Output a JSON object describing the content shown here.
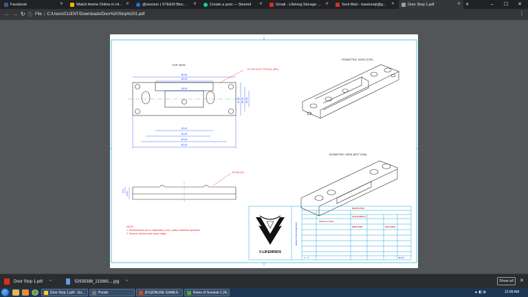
{
  "tabs": [
    {
      "title": "Facebook",
      "color": "#3b5998"
    },
    {
      "title": "Watch Anime Online in High Qu...",
      "color": "#f4b400"
    },
    {
      "title": "@sevison | STEEM Block Explorer",
      "color": "#1a73e8"
    },
    {
      "title": "Create a post — Steemit",
      "color": "#06d6a9"
    },
    {
      "title": "Gmail - Lifelong Storage at Email",
      "color": "#d93025"
    },
    {
      "title": "Sent Mail - maxtoneji@gmail.co...",
      "color": "#d93025"
    },
    {
      "title": "Door Stop 1.pdf",
      "color": "#9aa0a6"
    }
  ],
  "toolbar": {
    "back": "←",
    "forward": "→",
    "reload": "↻",
    "scheme": "File",
    "url": "C:/Users/CLIENT/Downloads/Door%20Stop%201.pdf",
    "menu": "⋮"
  },
  "window_controls": {
    "minimize": "–",
    "maximize": "☐",
    "close": "✕"
  },
  "drawing": {
    "top_view_title": "TOP VIEW",
    "iso_top_title": "ISOMETRIC VIEW (TOP)",
    "iso_bottom_title": "ISOMETRIC VIEW (BOTTOM)",
    "slot_note": "R 1.50 SLOT TYPICAL (4PL)",
    "side_callout": "R2.50 (2X)",
    "dims_top": [
      "80.00",
      "60.00",
      "18.00"
    ],
    "dims_bottom": [
      "30.00",
      "40.00",
      "60.00",
      "80.00"
    ],
    "dims_right": [
      "20.00",
      "25.00",
      "30.00"
    ],
    "side_dims": [
      "5.00",
      "12.00"
    ],
    "notes": [
      "NOTE:",
      "1. All dimensions are in millimeters ( mm ) unless otherwise specified.",
      "2. Remove all burrs and sharp edges."
    ],
    "brand": "V-LIKEMINDS",
    "website": "www.v-likeminds.com",
    "title_block": {
      "title": "DOOR STOP",
      "customer": "VLM-SAMPLE",
      "material": "Stainless Steel",
      "drawing_no": "DWG-0038",
      "date": "03/17/2019",
      "sheet": "1 : 1",
      "scale": "N.T.S."
    },
    "colors": {
      "border": "#1aa7d6",
      "lines": "#2a2a2a",
      "dims": "#1c40ff",
      "red": "#e8202a",
      "center": "#40b040"
    }
  },
  "downloads": [
    {
      "name": "Door Stop 1.pdf",
      "color": "#d93025"
    },
    {
      "name": "52935388_215681....jpg",
      "color": "#5aa0e6"
    }
  ],
  "downloads_show_all": "Show all",
  "taskbar": {
    "tasks": [
      {
        "label": "Door Stop 1.pdf - Go...",
        "color": "#ffcc33"
      },
      {
        "label": "Pondo",
        "color": "#777777"
      },
      {
        "label": "[FG]ONLINE GAMES-",
        "color": "#dd4422"
      },
      {
        "label": "Rules of Survival 1.24...",
        "color": "#44aa44"
      }
    ],
    "time": "12:09 AM"
  }
}
